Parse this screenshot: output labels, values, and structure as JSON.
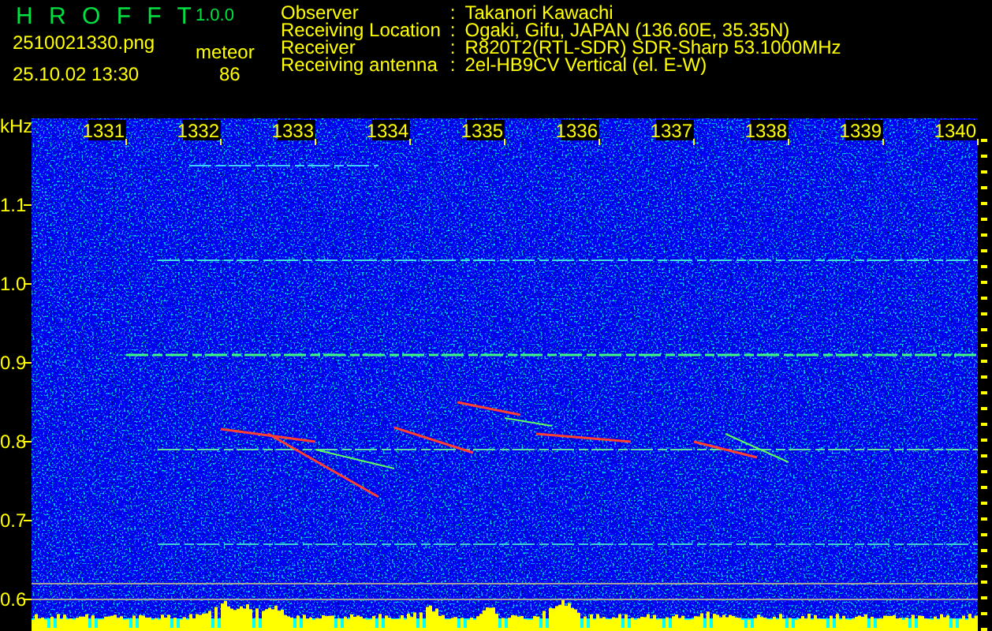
{
  "app": {
    "title": "H R O F F T",
    "version": "1.0.0"
  },
  "file": {
    "name": "2510021330.png",
    "datetime": "25.10.02 13:30"
  },
  "meteor": {
    "label": "meteor",
    "count": "86"
  },
  "info": [
    {
      "label": "Observer",
      "separator": ":",
      "value": "Takanori Kawachi"
    },
    {
      "label": "Receiving Location",
      "separator": ":",
      "value": "Ogaki, Gifu, JAPAN (136.60E, 35.35N)"
    },
    {
      "label": "Receiver",
      "separator": ":",
      "value": "R820T2(RTL-SDR) SDR-Sharp 53.1000MHz"
    },
    {
      "label": "Receiving antenna",
      "separator": ":",
      "value": "2el-HB9CV Vertical (el. E-W)"
    }
  ],
  "spectrogram": {
    "unit": "kHz",
    "x_labels": [
      "1331",
      "1332",
      "1333",
      "1334",
      "1335",
      "1336",
      "1337",
      "1338",
      "1339",
      "1340"
    ],
    "y_labels": [
      "1.1",
      "1.0",
      "0.9",
      "0.8",
      "0.7",
      "0.6"
    ]
  }
}
